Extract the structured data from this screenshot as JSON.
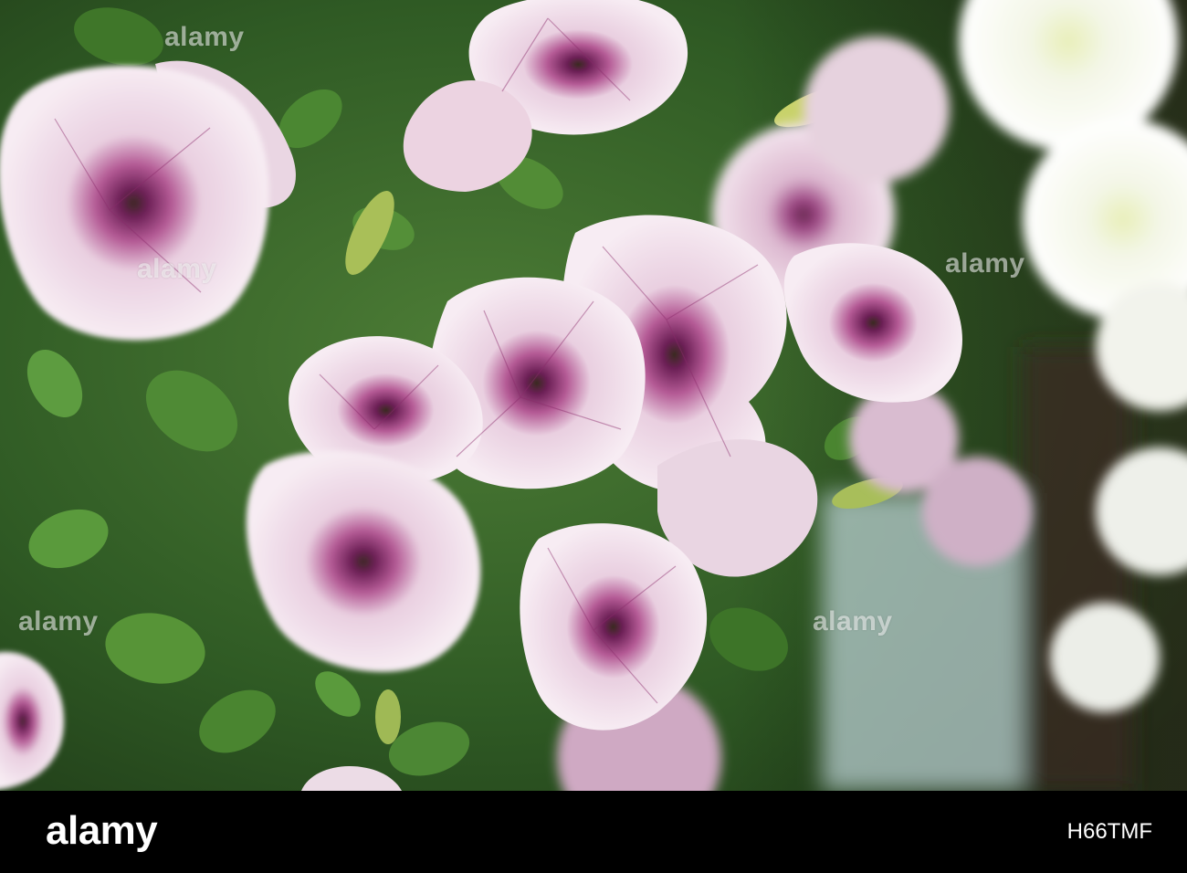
{
  "photo": {
    "subject": "pink petunia flowers",
    "colors": {
      "foliage": "#3c6a2c",
      "petal_light": "#f6e9f1",
      "petal_pink": "#e3bfd6",
      "vein": "#8a2a6a",
      "white_flower": "#f4f6ee"
    }
  },
  "watermark": {
    "text": "alamy"
  },
  "footer": {
    "logo": "alamy",
    "image_id": "H66TMF"
  }
}
